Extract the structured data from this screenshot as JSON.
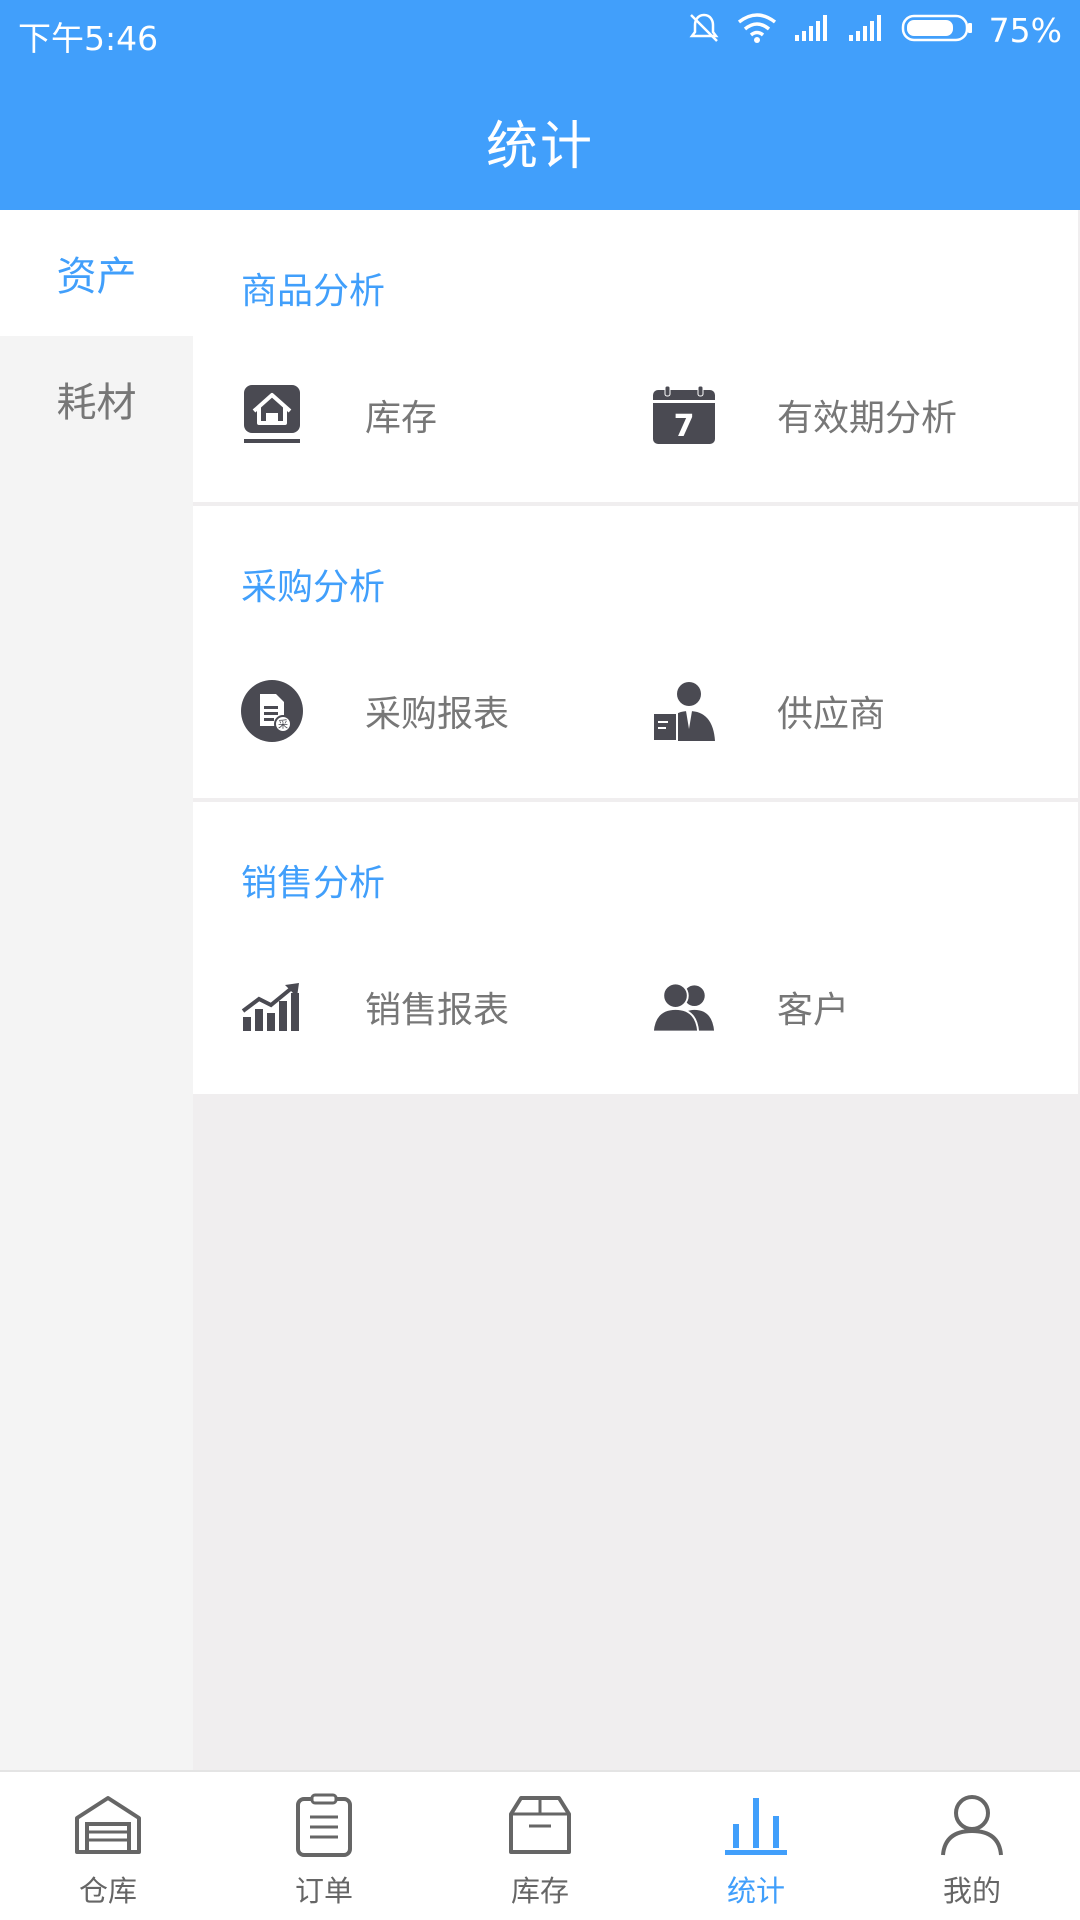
{
  "status_bar": {
    "time": "下午5:46",
    "battery": "75%"
  },
  "header": {
    "title": "统计"
  },
  "sidebar": {
    "items": [
      {
        "label": "资产",
        "active": true
      },
      {
        "label": "耗材",
        "active": false
      }
    ]
  },
  "sections": [
    {
      "title": "商品分析",
      "entries": [
        {
          "label": "库存",
          "icon": "warehouse-icon"
        },
        {
          "label": "有效期分析",
          "icon": "calendar-icon"
        }
      ]
    },
    {
      "title": "采购分析",
      "entries": [
        {
          "label": "采购报表",
          "icon": "purchase-report-icon"
        },
        {
          "label": "供应商",
          "icon": "supplier-icon"
        }
      ]
    },
    {
      "title": "销售分析",
      "entries": [
        {
          "label": "销售报表",
          "icon": "sales-chart-icon"
        },
        {
          "label": "客户",
          "icon": "customers-icon"
        }
      ]
    }
  ],
  "bottom_nav": {
    "tabs": [
      {
        "label": "仓库",
        "icon": "garage-icon"
      },
      {
        "label": "订单",
        "icon": "clipboard-icon"
      },
      {
        "label": "库存",
        "icon": "box-icon"
      },
      {
        "label": "统计",
        "icon": "bar-chart-icon",
        "active": true
      },
      {
        "label": "我的",
        "icon": "user-icon"
      }
    ]
  },
  "colors": {
    "accent": "#419ffb",
    "icon_dark": "#4a4a52",
    "text_gray": "#777777"
  }
}
